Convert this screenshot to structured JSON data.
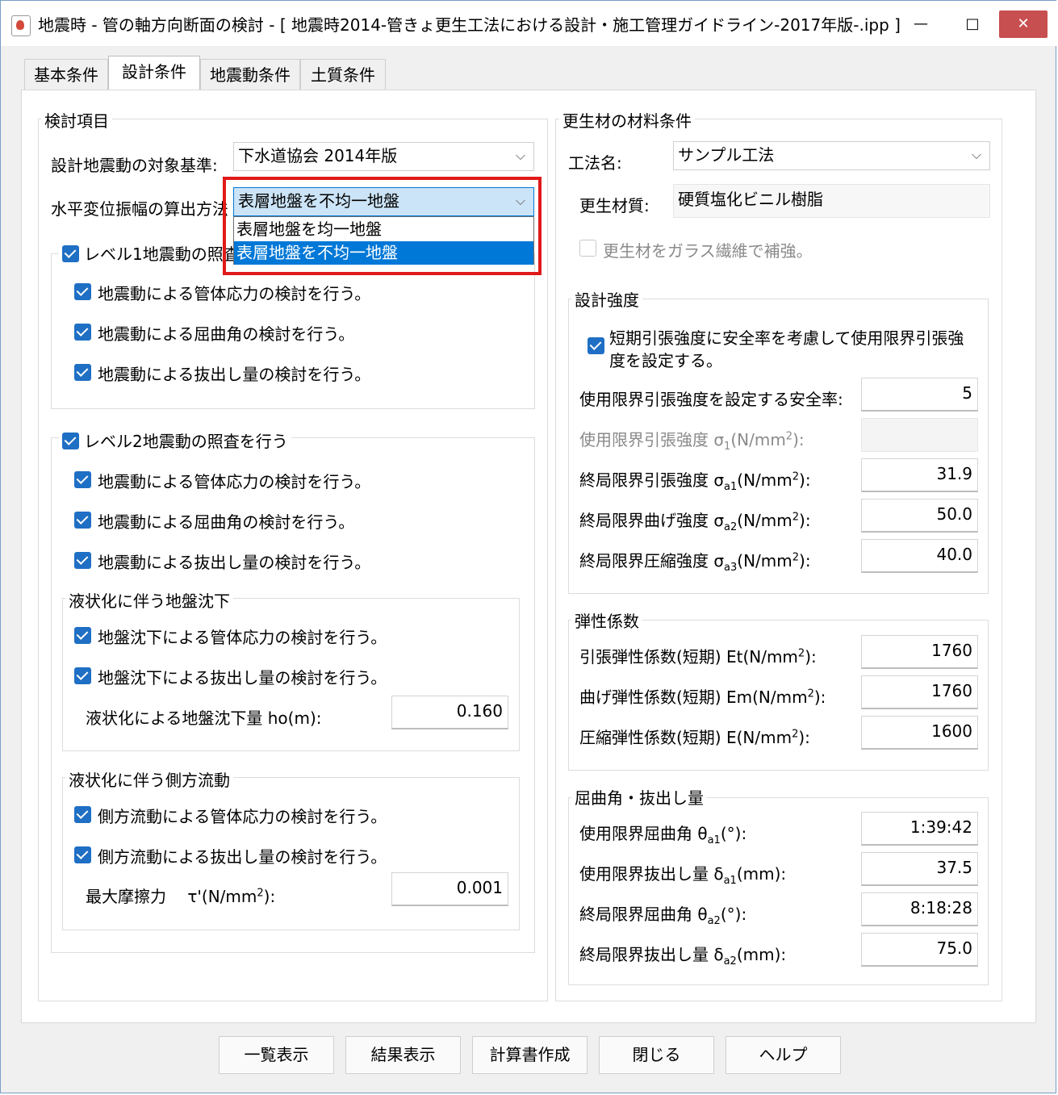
{
  "window": {
    "title": "地震時 - 管の軸方向断面の検討 - [ 地震時2014-管きょ更生工法における設計・施工管理ガイドライン-2017年版-.ipp ]",
    "minimize": "—",
    "maximize": "□",
    "close": "✕"
  },
  "tabs": [
    "基本条件",
    "設計条件",
    "地震動条件",
    "土質条件"
  ],
  "left": {
    "group_title": "検討項目",
    "standard_label": "設計地震動の対象基準:",
    "standard_value": "下水道協会 2014年版",
    "method_label": "水平変位振幅の算出方法",
    "method_value": "表層地盤を不均一地盤",
    "dropdown_options": [
      "表層地盤を均一地盤",
      "表層地盤を不均一地盤"
    ],
    "level1": {
      "title": "レベル1地震動の照査を行う",
      "items": [
        "地震動による管体応力の検討を行う。",
        "地震動による屈曲角の検討を行う。",
        "地震動による抜出し量の検討を行う。"
      ]
    },
    "level2": {
      "title": "レベル2地震動の照査を行う",
      "items": [
        "地震動による管体応力の検討を行う。",
        "地震動による屈曲角の検討を行う。",
        "地震動による抜出し量の検討を行う。"
      ]
    },
    "settlement": {
      "title": "液状化に伴う地盤沈下",
      "items": [
        "地盤沈下による管体応力の検討を行う。",
        "地盤沈下による抜出し量の検討を行う。"
      ],
      "field_label": "液状化による地盤沈下量 ho(m):",
      "field_value": "0.160"
    },
    "lateral": {
      "title": "液状化に伴う側方流動",
      "items": [
        "側方流動による管体応力の検討を行う。",
        "側方流動による抜出し量の検討を行う。"
      ],
      "field_label_pre": "最大摩擦力　 τ'(N/mm",
      "field_label_sup": "2",
      "field_label_post": "):",
      "field_value": "0.001"
    }
  },
  "right": {
    "group_title": "更生材の材料条件",
    "method_label": "工法名:",
    "method_value": "サンプル工法",
    "material_label": "更生材質:",
    "material_value": "硬質塩化ビニル樹脂",
    "glass_label": "更生材をガラス繊維で補強。",
    "strength": {
      "title": "設計強度",
      "check_label": "短期引張強度に安全率を考慮して使用限界引張強度を設定する。",
      "check_line1": "短期引張強度に安全率を考慮して使用限界引張強",
      "check_line2": "度を設定する。",
      "safety_label": "使用限界引張強度を設定する安全率:",
      "safety_value": "5",
      "rows": [
        {
          "pre": "使用限界引張強度 σ",
          "sub": "1",
          "mid": "(N/mm",
          "sup": "2",
          "post": "):",
          "value": ""
        },
        {
          "pre": "終局限界引張強度 σ",
          "sub": "a1",
          "mid": "(N/mm",
          "sup": "2",
          "post": "):",
          "value": "31.9"
        },
        {
          "pre": "終局限界曲げ強度 σ",
          "sub": "a2",
          "mid": "(N/mm",
          "sup": "2",
          "post": "):",
          "value": "50.0"
        },
        {
          "pre": "終局限界圧縮強度 σ",
          "sub": "a3",
          "mid": "(N/mm",
          "sup": "2",
          "post": "):",
          "value": "40.0"
        }
      ]
    },
    "elastic": {
      "title": "弾性係数",
      "rows": [
        {
          "pre": "引張弾性係数(短期) Et(N/mm",
          "sup": "2",
          "post": "):",
          "value": "1760"
        },
        {
          "pre": "曲げ弾性係数(短期) Em(N/mm",
          "sup": "2",
          "post": "):",
          "value": "1760"
        },
        {
          "pre": "圧縮弾性係数(短期) E(N/mm",
          "sup": "2",
          "post": "):",
          "value": "1600"
        }
      ]
    },
    "bend": {
      "title": "屈曲角・抜出し量",
      "rows": [
        {
          "pre": "使用限界屈曲角 θ",
          "sub": "a1",
          "post": "(°):",
          "value": "1:39:42"
        },
        {
          "pre": "使用限界抜出し量 δ",
          "sub": "a1",
          "post": "(mm):",
          "value": "37.5"
        },
        {
          "pre": "終局限界屈曲角 θ",
          "sub": "a2",
          "post": "(°):",
          "value": "8:18:28"
        },
        {
          "pre": "終局限界抜出し量 δ",
          "sub": "a2",
          "post": "(mm):",
          "value": "75.0"
        }
      ]
    }
  },
  "buttons": [
    "一覧表示",
    "結果表示",
    "計算書作成",
    "閉じる",
    "ヘルプ"
  ]
}
